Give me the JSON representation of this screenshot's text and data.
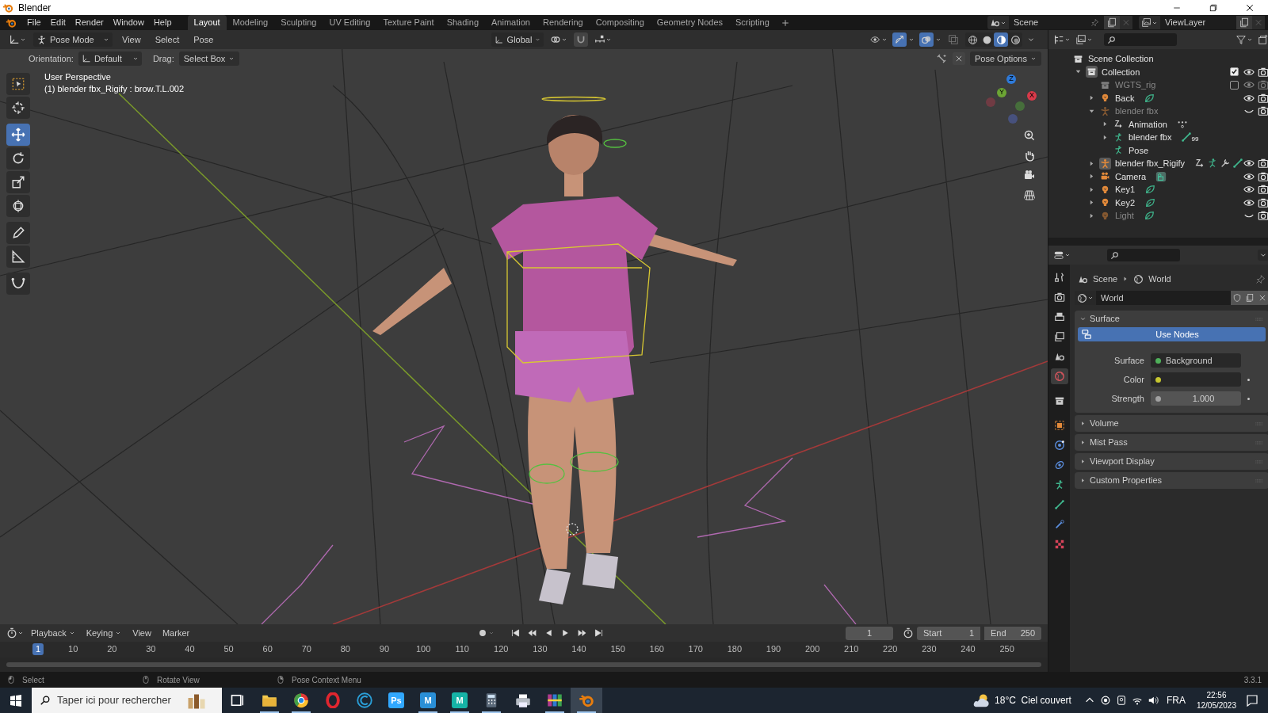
{
  "window": {
    "title": "Blender"
  },
  "menu": [
    "File",
    "Edit",
    "Render",
    "Window",
    "Help"
  ],
  "workspaces": [
    {
      "label": "Layout",
      "selected": true
    },
    {
      "label": "Modeling",
      "selected": false
    },
    {
      "label": "Sculpting",
      "selected": false
    },
    {
      "label": "UV Editing",
      "selected": false
    },
    {
      "label": "Texture Paint",
      "selected": false
    },
    {
      "label": "Shading",
      "selected": false
    },
    {
      "label": "Animation",
      "selected": false
    },
    {
      "label": "Rendering",
      "selected": false
    },
    {
      "label": "Compositing",
      "selected": false
    },
    {
      "label": "Geometry Nodes",
      "selected": false
    },
    {
      "label": "Scripting",
      "selected": false
    }
  ],
  "scene": "Scene",
  "view_layer": "ViewLayer",
  "viewport": {
    "mode": "Pose Mode",
    "show_gizmos": true,
    "show_overlays": true,
    "menus": [
      "View",
      "Select",
      "Pose"
    ],
    "transform": "Global",
    "shading": [
      {
        "kind": "wireframe",
        "selected": false
      },
      {
        "kind": "solid",
        "selected": false
      },
      {
        "kind": "material",
        "selected": true
      },
      {
        "kind": "rendered",
        "selected": false
      }
    ],
    "orientation_label": "Orientation:",
    "orientation": "Default",
    "drag_label": "Drag:",
    "drag": "Select Box",
    "pose_options": "Pose Options",
    "info": [
      "User Perspective",
      "(1) blender fbx_Rigify : brow.T.L.002"
    ],
    "tools": [
      {
        "kind": "select",
        "selected": false
      },
      {
        "kind": "cursor",
        "selected": false
      },
      {
        "kind": "move",
        "selected": true
      },
      {
        "kind": "rotate",
        "selected": false
      },
      {
        "kind": "scale",
        "selected": false
      },
      {
        "kind": "transform",
        "selected": false
      },
      {
        "kind": "annotate",
        "selected": false
      },
      {
        "kind": "measure",
        "selected": false
      },
      {
        "kind": "bone",
        "selected": false
      }
    ],
    "gizmo": {
      "x": "X",
      "y": "Y",
      "z": "Z"
    }
  },
  "outliner": {
    "items": [
      {
        "label": "Scene Collection",
        "kind": "collection",
        "children": [
          {
            "label": "Collection",
            "kind": "collection",
            "expanded": true,
            "active": true,
            "checked": true,
            "visible": true,
            "children": [
              {
                "label": "WGTS_rig",
                "kind": "collection",
                "checked": false,
                "visible": true
              },
              {
                "label": "Back",
                "kind": "light",
                "expanded": false,
                "visible": true,
                "extras": [
                  {
                    "kind": "light-data"
                  }
                ]
              },
              {
                "label": "blender fbx",
                "kind": "armature",
                "expanded": true,
                "visible": false,
                "children": [
                  {
                    "label": "Animation",
                    "kind": "action",
                    "expanded": false,
                    "extras": [
                      {
                        "kind": "keyframes"
                      }
                    ]
                  },
                  {
                    "label": "blender fbx",
                    "kind": "armature-data",
                    "expanded": false,
                    "extras": [
                      {
                        "kind": "bone"
                      }
                    ],
                    "badge": "99"
                  },
                  {
                    "label": "Pose",
                    "kind": "pose"
                  }
                ]
              },
              {
                "label": "blender fbx_Rigify",
                "kind": "armature",
                "expanded": false,
                "active": true,
                "visible": true,
                "extras": [
                  {
                    "kind": "action"
                  },
                  {
                    "kind": "pose"
                  },
                  {
                    "kind": "wrench"
                  },
                  {
                    "kind": "bone"
                  }
                ]
              },
              {
                "label": "Camera",
                "kind": "camera",
                "expanded": false,
                "visible": true,
                "extras": [
                  {
                    "kind": "camera-data"
                  }
                ]
              },
              {
                "label": "Key1",
                "kind": "light",
                "expanded": false,
                "visible": true,
                "extras": [
                  {
                    "kind": "light-data"
                  }
                ]
              },
              {
                "label": "Key2",
                "kind": "light",
                "expanded": false,
                "visible": true,
                "extras": [
                  {
                    "kind": "light-data"
                  }
                ]
              },
              {
                "label": "Light",
                "kind": "light",
                "expanded": false,
                "visible": false,
                "extras": [
                  {
                    "kind": "light-data"
                  }
                ]
              }
            ]
          }
        ]
      }
    ]
  },
  "properties": {
    "tabs": [
      {
        "kind": "tool",
        "selected": false
      },
      {
        "kind": "render",
        "selected": false
      },
      {
        "kind": "output",
        "selected": false
      },
      {
        "kind": "view-layer",
        "selected": false
      },
      {
        "kind": "scene",
        "selected": false
      },
      {
        "kind": "world",
        "selected": true
      },
      {
        "kind": "collection",
        "selected": false
      },
      {
        "kind": "object",
        "selected": false
      },
      {
        "kind": "physics",
        "selected": false
      },
      {
        "kind": "constraints",
        "selected": false
      },
      {
        "kind": "data",
        "selected": false
      },
      {
        "kind": "bone",
        "selected": false
      },
      {
        "kind": "bone-constraint",
        "selected": false
      },
      {
        "kind": "texture",
        "selected": false
      }
    ],
    "breadcrumb": [
      "Scene",
      "World"
    ],
    "world": "World",
    "panels": [
      {
        "label": "Surface",
        "expanded": true
      },
      {
        "label": "Volume",
        "expanded": false
      },
      {
        "label": "Mist Pass",
        "expanded": false
      },
      {
        "label": "Viewport Display",
        "expanded": false
      },
      {
        "label": "Custom Properties",
        "expanded": false
      }
    ],
    "use_nodes": {
      "label": "Use Nodes",
      "on": true
    },
    "fields": [
      {
        "label": "Surface",
        "kind": "link",
        "value": "Background",
        "color": "#4fb05a"
      },
      {
        "label": "Color",
        "kind": "color",
        "color": "#c7c730"
      },
      {
        "label": "Strength",
        "kind": "number",
        "value": "1.000",
        "color": "#a1a1a1"
      }
    ]
  },
  "timeline": {
    "menus": [
      "Playback",
      "Keying",
      "View",
      "Marker"
    ],
    "current": "1",
    "start_label": "Start",
    "start": "1",
    "end_label": "End",
    "end": "250",
    "ticks": [
      {
        "label": "1",
        "selected": true
      },
      {
        "label": "10",
        "selected": false
      },
      {
        "label": "20",
        "selected": false
      },
      {
        "label": "30",
        "selected": false
      },
      {
        "label": "40",
        "selected": false
      },
      {
        "label": "50",
        "selected": false
      },
      {
        "label": "60",
        "selected": false
      },
      {
        "label": "70",
        "selected": false
      },
      {
        "label": "80",
        "selected": false
      },
      {
        "label": "90",
        "selected": false
      },
      {
        "label": "100",
        "selected": false
      },
      {
        "label": "110",
        "selected": false
      },
      {
        "label": "120",
        "selected": false
      },
      {
        "label": "130",
        "selected": false
      },
      {
        "label": "140",
        "selected": false
      },
      {
        "label": "150",
        "selected": false
      },
      {
        "label": "160",
        "selected": false
      },
      {
        "label": "170",
        "selected": false
      },
      {
        "label": "180",
        "selected": false
      },
      {
        "label": "190",
        "selected": false
      },
      {
        "label": "200",
        "selected": false
      },
      {
        "label": "210",
        "selected": false
      },
      {
        "label": "220",
        "selected": false
      },
      {
        "label": "230",
        "selected": false
      },
      {
        "label": "240",
        "selected": false
      },
      {
        "label": "250",
        "selected": false
      }
    ]
  },
  "status_bar": {
    "items": [
      "Select",
      "Rotate View",
      "Pose Context Menu"
    ],
    "version": "3.3.1"
  },
  "taskbar": {
    "search_placeholder": "Taper ici pour rechercher",
    "apps": [
      {
        "kind": "task-view",
        "running": false,
        "active": false
      },
      {
        "kind": "folder",
        "running": true,
        "active": false
      },
      {
        "kind": "browser",
        "running": true,
        "active": false
      },
      {
        "kind": "ring",
        "running": false,
        "active": false
      },
      {
        "kind": "c",
        "running": false,
        "active": false
      },
      {
        "kind": "letter",
        "label": "Ps",
        "color": "#31a8ff",
        "running": false,
        "active": false
      },
      {
        "kind": "letter",
        "label": "M",
        "color": "#2a8fd6",
        "running": true,
        "active": false
      },
      {
        "kind": "letter",
        "label": "M",
        "color": "#16b3a6",
        "running": true,
        "active": false
      },
      {
        "kind": "calculator",
        "running": true,
        "active": false
      },
      {
        "kind": "printer",
        "running": false,
        "active": false
      },
      {
        "kind": "archive",
        "running": true,
        "active": false
      },
      {
        "kind": "logo",
        "running": true,
        "active": true
      }
    ],
    "weather": "18°C  Ciel couvert",
    "language": "FRA",
    "time": "22:56",
    "date": "12/05/2023"
  }
}
